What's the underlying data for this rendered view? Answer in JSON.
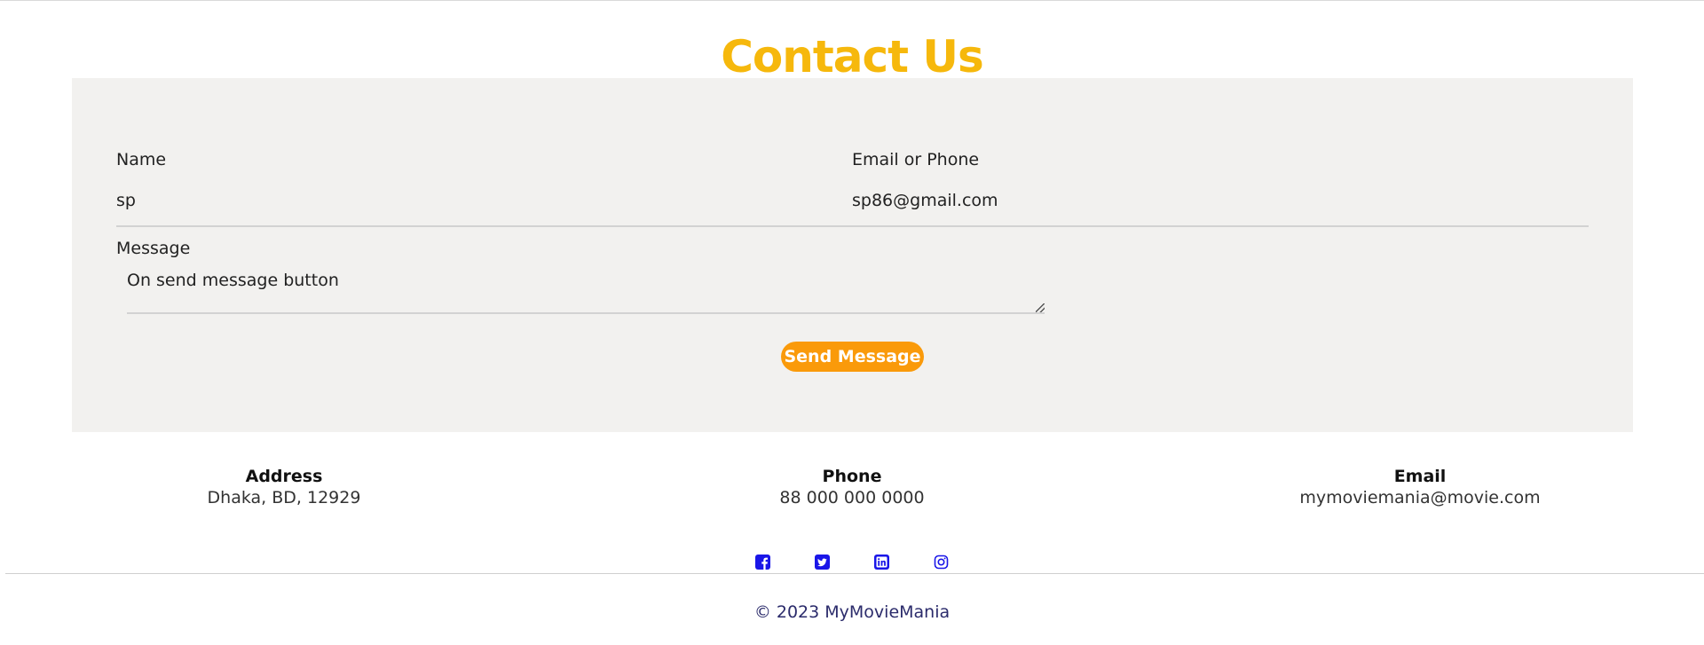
{
  "header": {
    "title": "Contact Us"
  },
  "form": {
    "name_label": "Name",
    "name_value": "sp",
    "email_label": "Email or Phone",
    "email_value": "sp86@gmail.com",
    "message_label": "Message",
    "message_value": "On send message button",
    "send_label": "Send Message"
  },
  "info": {
    "address_title": "Address",
    "address_value": "Dhaka, BD, 12929",
    "phone_title": "Phone",
    "phone_value": "88 000 000 0000",
    "email_title": "Email",
    "email_value": "mymoviemania@movie.com"
  },
  "social": {
    "icons": [
      "facebook-icon",
      "twitter-icon",
      "linkedin-icon",
      "instagram-icon"
    ]
  },
  "footer": {
    "copyright": "© 2023 MyMovieMania"
  },
  "colors": {
    "title": "#f6b80c",
    "button": "#fa9a0a",
    "panel": "#f2f1ef",
    "social": "#1a16e8",
    "footer_text": "#2b2b6b"
  }
}
